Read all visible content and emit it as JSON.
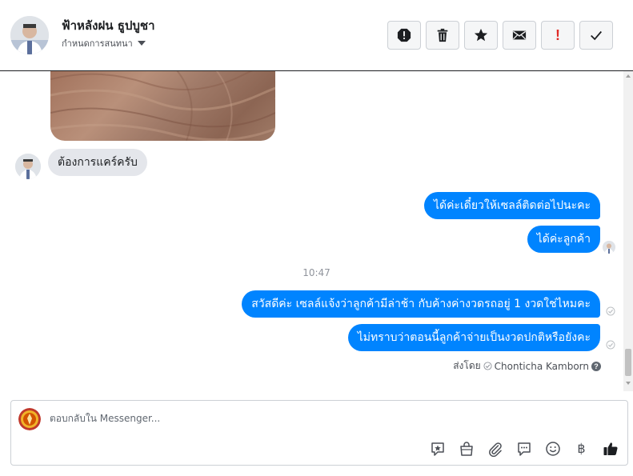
{
  "header": {
    "contact_name": "ฟ้าหลังฝน ธูปบูชา",
    "conversation_settings": "กำหนดการสนทนา",
    "toolbar": [
      {
        "name": "spam-button",
        "icon": "exclamation-octagon-icon"
      },
      {
        "name": "delete-button",
        "icon": "trash-icon"
      },
      {
        "name": "star-button",
        "icon": "star-icon"
      },
      {
        "name": "mark-unread-button",
        "icon": "envelope-icon"
      },
      {
        "name": "follow-up-button",
        "icon": "exclamation-icon",
        "label": "!"
      },
      {
        "name": "mark-done-button",
        "icon": "checkmark-icon"
      }
    ]
  },
  "messages": [
    {
      "direction": "incoming",
      "text": "ต้องการแคร์ครับ"
    },
    {
      "direction": "outgoing",
      "text": "ได้ค่ะเดี๋ยวให้เซลล์ติดต่อไปนะคะ"
    },
    {
      "direction": "outgoing",
      "text": "ได้ค่ะลูกค้า"
    },
    {
      "direction": "outgoing",
      "text": "สวัสดีค่ะ  เซลล์แจ้งว่าลูกค้ามีล่าช้า กับค้างค่างวดรถอยู่ 1 งวดใช่ไหมคะ"
    },
    {
      "direction": "outgoing",
      "text": "ไม่ทราบว่าตอนนี้ลูกค้าจ่ายเป็นงวดปกติหรือยังคะ"
    }
  ],
  "timestamp": "10:47",
  "sent_by": {
    "prefix": "ส่งโดย",
    "name": "Chonticha Kamborn"
  },
  "composer": {
    "placeholder": "ตอบกลับใน Messenger...",
    "tools": [
      "saved-reply-icon",
      "shop-bag-icon",
      "paperclip-icon",
      "chat-bubble-icon",
      "emoji-icon",
      "baht-icon",
      "thumbs-up-icon"
    ],
    "baht_symbol": "฿"
  },
  "colors": {
    "outgoing_bubble": "#0084ff",
    "incoming_bubble": "#e4e6eb"
  }
}
